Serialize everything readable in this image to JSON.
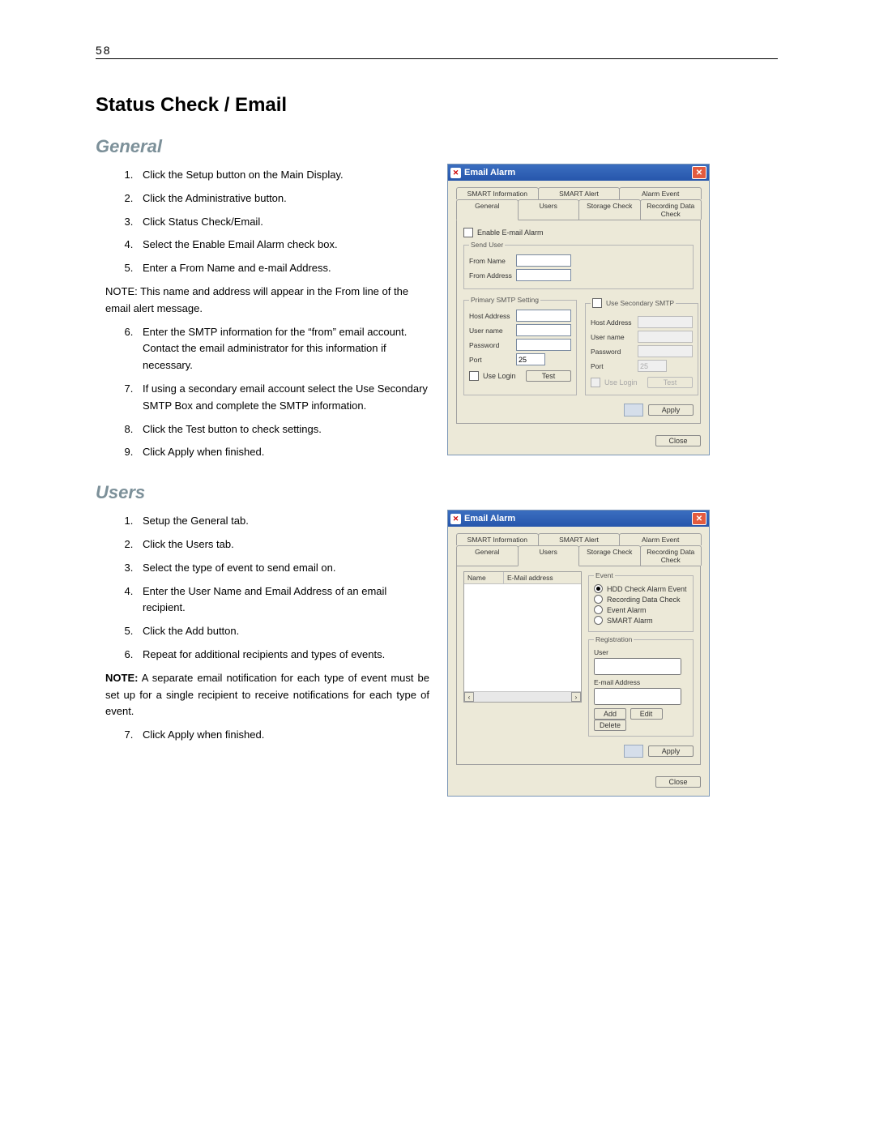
{
  "page_number": "58",
  "title": "Status Check / Email",
  "sections": {
    "general": {
      "heading": "General",
      "steps": [
        "Click the Setup button on the Main Display.",
        "Click the Administrative button.",
        "Click Status Check/Email.",
        "Select the Enable Email Alarm check box.",
        "Enter a From Name and e-mail Address."
      ],
      "note1": "NOTE: This name and address will appear in the From line of the email alert message.",
      "steps2": [
        "Enter the SMTP information for the “from” email account.  Contact the email administrator for this information if necessary.",
        "If using a secondary email account select the Use Secondary SMTP Box and complete the SMTP information.",
        "Click the Test button to check settings.",
        "Click Apply when finished."
      ]
    },
    "users": {
      "heading": "Users",
      "steps": [
        "Setup the General tab.",
        "Click the Users tab.",
        "Select the type of event to send email on.",
        "Enter the User Name and Email Address of an email recipient.",
        "Click the Add button.",
        "Repeat for additional recipients and types of events."
      ],
      "note_label": "NOTE:",
      "note_text": "  A separate email notification for each type of event must be set up for a single recipient to receive notifications for each type of event.",
      "steps2": [
        "Click Apply when finished."
      ]
    }
  },
  "dialog_general": {
    "title": "Email Alarm",
    "tabs_back": [
      "SMART Information",
      "SMART Alert",
      "Alarm Event"
    ],
    "tabs_front": [
      "General",
      "Users",
      "Storage Check",
      "Recording Data Check"
    ],
    "active_tab": "General",
    "enable_label": "Enable E-mail Alarm",
    "send_user": {
      "legend": "Send User",
      "from_name_label": "From Name",
      "from_addr_label": "From Address"
    },
    "primary": {
      "legend": "Primary SMTP Setting",
      "host_label": "Host Address",
      "user_label": "User name",
      "pass_label": "Password",
      "port_label": "Port",
      "port_value": "25",
      "use_login_label": "Use Login",
      "test_label": "Test"
    },
    "secondary": {
      "checkbox_label": "Use Secondary SMTP",
      "host_label": "Host Address",
      "user_label": "User name",
      "pass_label": "Password",
      "port_label": "Port",
      "port_value": "25",
      "use_login_label": "Use Login",
      "test_label": "Test"
    },
    "apply_label": "Apply",
    "close_label": "Close"
  },
  "dialog_users": {
    "title": "Email Alarm",
    "tabs_back": [
      "SMART Information",
      "SMART Alert",
      "Alarm Event"
    ],
    "tabs_front": [
      "General",
      "Users",
      "Storage Check",
      "Recording Data Check"
    ],
    "active_tab": "Users",
    "list_headers": [
      "Name",
      "E-Mail address"
    ],
    "event": {
      "legend": "Event",
      "options": [
        "HDD Check Alarm Event",
        "Recording Data Check",
        "Event Alarm",
        "SMART Alarm"
      ],
      "selected_index": 0
    },
    "registration": {
      "legend": "Registration",
      "user_label": "User",
      "email_label": "E-mail Address",
      "add_label": "Add",
      "edit_label": "Edit",
      "delete_label": "Delete"
    },
    "apply_label": "Apply",
    "close_label": "Close"
  }
}
